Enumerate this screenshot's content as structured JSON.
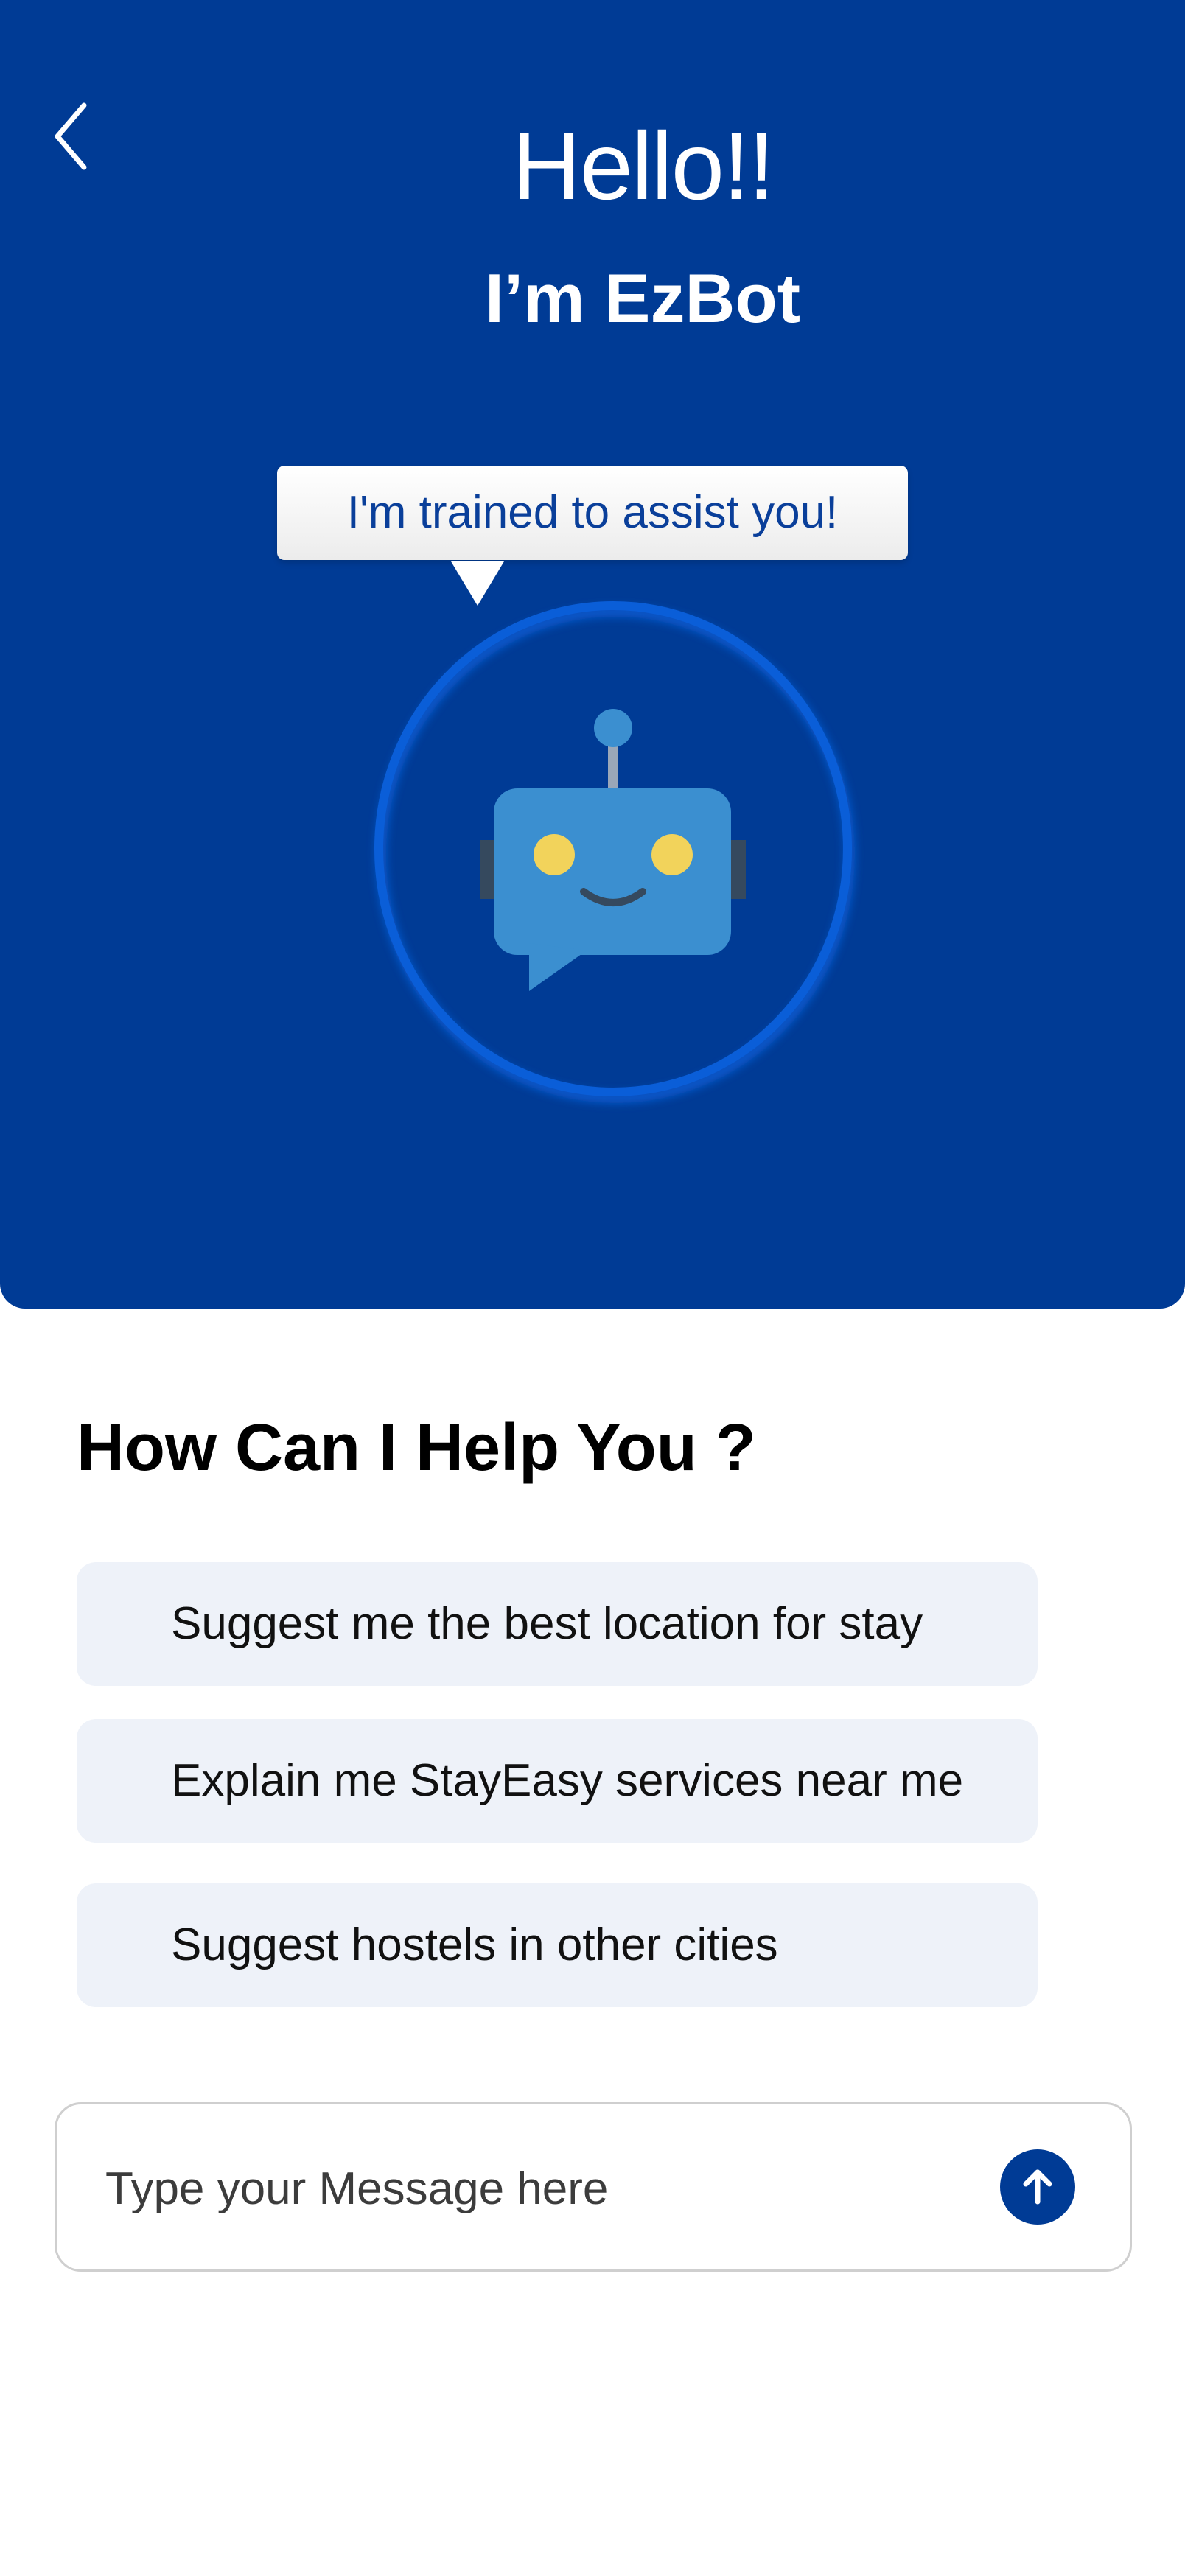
{
  "header": {
    "greeting": "Hello!!",
    "subtitle": "I’m EzBot",
    "bubble_text": "I'm trained to assist you!"
  },
  "colors": {
    "primary": "#003b95",
    "chip_bg": "#eef2f9",
    "robot_body": "#3b8fd0",
    "robot_eye": "#f2d35b",
    "ring": "#0a5ed8"
  },
  "icons": {
    "back": "chevron-left-icon",
    "send": "arrow-up-icon",
    "robot": "chatbot-robot-icon"
  },
  "main": {
    "title": "How Can I Help You ?",
    "suggestions": [
      "Suggest me the best location for stay",
      "Explain me StayEasy services near me",
      "Suggest hostels in other cities"
    ]
  },
  "composer": {
    "placeholder": "Type your Message here",
    "value": ""
  }
}
